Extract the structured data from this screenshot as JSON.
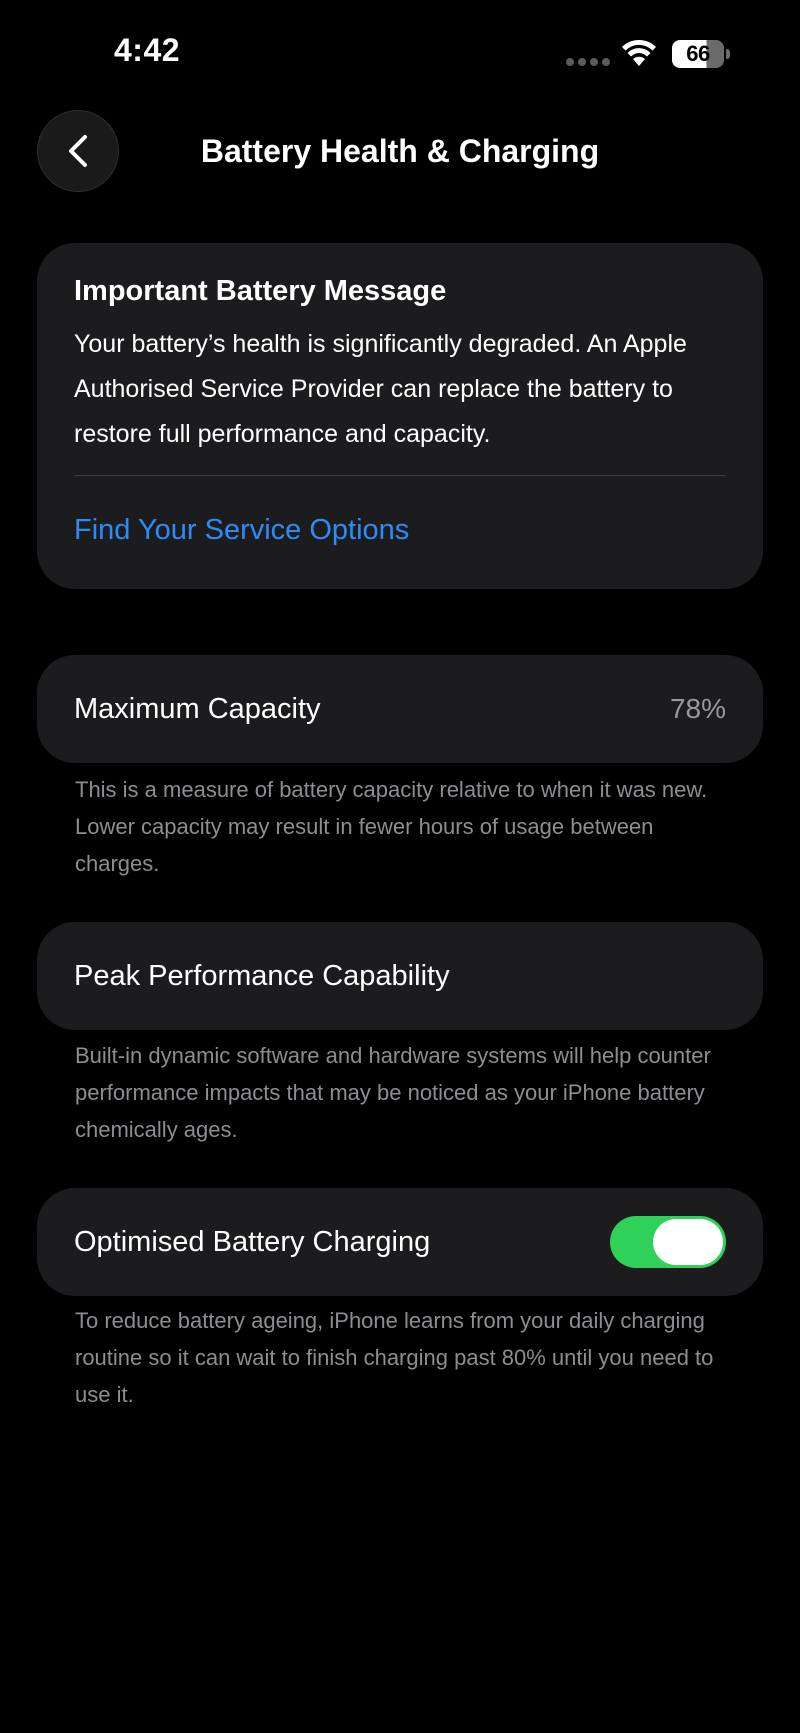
{
  "status_bar": {
    "time": "4:42",
    "battery_level": "66",
    "battery_fraction": 0.66,
    "icons": [
      "signal-dots-icon",
      "wifi-icon",
      "battery-icon"
    ]
  },
  "nav": {
    "back_icon": "chevron-left-icon",
    "title": "Battery Health & Charging"
  },
  "message": {
    "title": "Important Battery Message",
    "body": "Your battery’s health is significantly degraded. An Apple Authorised Service Provider can replace the battery to restore full performance and capacity.",
    "link": "Find Your Service Options"
  },
  "capacity": {
    "label": "Maximum Capacity",
    "value": "78%",
    "note": "This is a measure of battery capacity relative to when it was new. Lower capacity may result in fewer hours of usage between charges."
  },
  "peak": {
    "label": "Peak Performance Capability",
    "note": "Built-in dynamic software and hardware systems will help counter performance impacts that may be noticed as your iPhone battery chemically ages."
  },
  "charging": {
    "label": "Optimised Battery Charging",
    "enabled": true,
    "note": "To reduce battery ageing, iPhone learns from your daily charging routine so it can wait to finish charging past 80% until you need to use it."
  },
  "colors": {
    "background": "#000000",
    "card": "#1c1c1e",
    "link": "#2c8cf4",
    "toggle_on": "#30d158",
    "secondary_text": "#8d8d92"
  }
}
